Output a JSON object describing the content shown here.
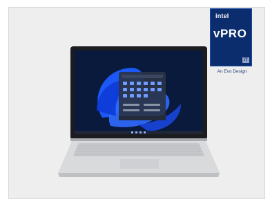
{
  "badge": {
    "brand": "intel",
    "product": "vPRO",
    "generation": "i7",
    "caption": "An Evo Design"
  },
  "image": {
    "subject": "laptop-icon",
    "screen_colors": {
      "wallpaper_bg": "#0a1a3d",
      "bloom": "#1d5cff",
      "start_menu": "#2a3346"
    },
    "body_color": "#d9dadc"
  }
}
